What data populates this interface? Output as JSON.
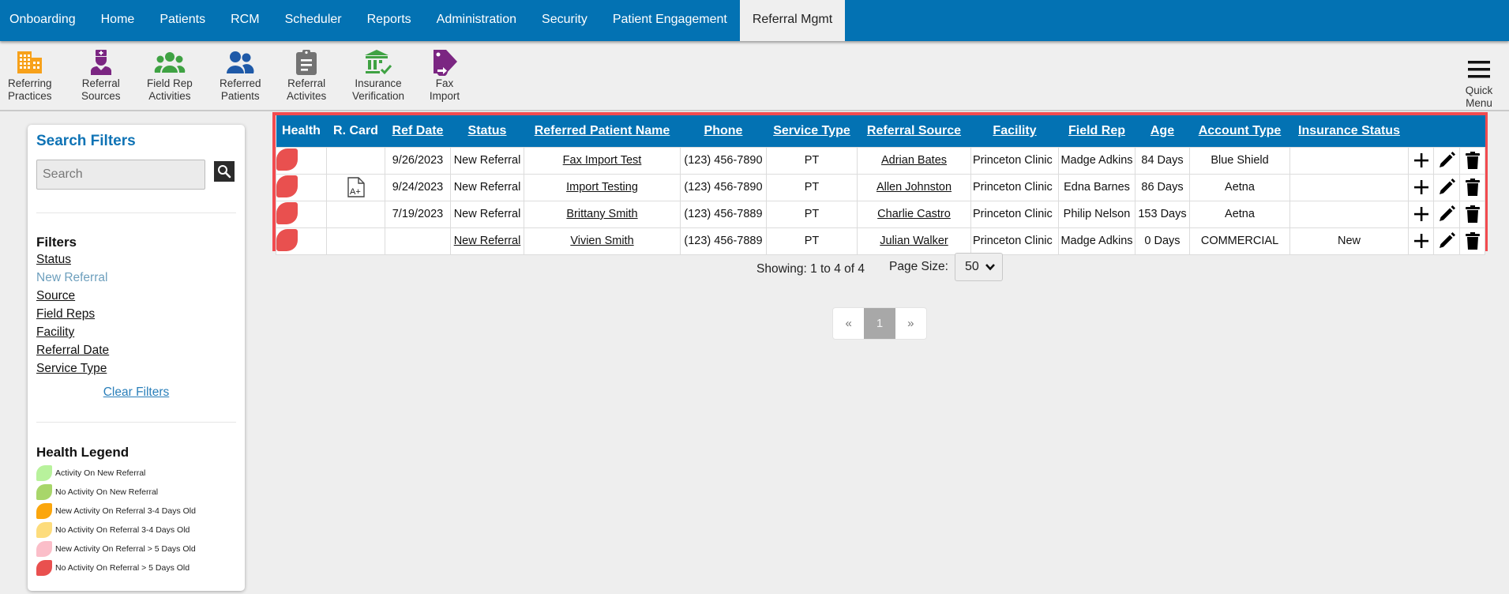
{
  "nav": {
    "items": [
      {
        "label": "Onboarding",
        "active": false
      },
      {
        "label": "Home",
        "active": false
      },
      {
        "label": "Patients",
        "active": false
      },
      {
        "label": "RCM",
        "active": false
      },
      {
        "label": "Scheduler",
        "active": false
      },
      {
        "label": "Reports",
        "active": false
      },
      {
        "label": "Administration",
        "active": false
      },
      {
        "label": "Security",
        "active": false
      },
      {
        "label": "Patient Engagement",
        "active": false
      },
      {
        "label": "Referral Mgmt",
        "active": true
      }
    ]
  },
  "toolbar": {
    "items": [
      {
        "line1": "Referring",
        "line2": "Practices",
        "icon": "building-icon",
        "color": "#f7a11a"
      },
      {
        "line1": "Referral",
        "line2": "Sources",
        "icon": "doctor-icon",
        "color": "#7b2682"
      },
      {
        "line1": "Field Rep",
        "line2": "Activities",
        "icon": "users-group-icon",
        "color": "#3fa243"
      },
      {
        "line1": "Referred",
        "line2": "Patients",
        "icon": "user-friends-icon",
        "color": "#1f5aa8"
      },
      {
        "line1": "Referral",
        "line2": "Activites",
        "icon": "clipboard-icon",
        "color": "#737373"
      },
      {
        "line1": "Insurance",
        "line2": "Verification",
        "icon": "bank-check-icon",
        "color": "#3fa243"
      },
      {
        "line1": "Fax",
        "line2": "Import",
        "icon": "tag-import-icon",
        "color": "#7b2682"
      }
    ],
    "quick_menu": {
      "line1": "Quick",
      "line2": "Menu",
      "icon": "hamburger-icon"
    }
  },
  "sidebar": {
    "title": "Search Filters",
    "search_placeholder": "Search",
    "search_value": "",
    "filters_title": "Filters",
    "status_label": "Status",
    "status_active": "New Referral",
    "filters": [
      "Source",
      "Field Reps",
      "Facility",
      "Referral Date",
      "Service Type"
    ],
    "clear_label": "Clear Filters",
    "legend_title": "Health Legend",
    "legend": [
      {
        "label": "Activity On New Referral",
        "color": "#b8f29c"
      },
      {
        "label": "No Activity On New Referral",
        "color": "#a8d66a"
      },
      {
        "label": "New Activity On Referral 3-4 Days Old",
        "color": "#fba60c"
      },
      {
        "label": "No Activity On Referral 3-4 Days Old",
        "color": "#fddc7c"
      },
      {
        "label": "New Activity On Referral > 5 Days Old",
        "color": "#fbbec9"
      },
      {
        "label": "No Activity On Referral > 5 Days Old",
        "color": "#e9504f"
      }
    ]
  },
  "table": {
    "columns": [
      {
        "label": "Health",
        "sortable": false
      },
      {
        "label": "R. Card",
        "sortable": false
      },
      {
        "label": "Ref Date",
        "sortable": true
      },
      {
        "label": "Status",
        "sortable": true
      },
      {
        "label": "Referred Patient Name",
        "sortable": true
      },
      {
        "label": "Phone",
        "sortable": true
      },
      {
        "label": "Service Type",
        "sortable": true
      },
      {
        "label": "Referral Source",
        "sortable": true
      },
      {
        "label": "Facility",
        "sortable": true
      },
      {
        "label": "Field Rep",
        "sortable": true
      },
      {
        "label": "Age",
        "sortable": true
      },
      {
        "label": "Account Type",
        "sortable": true
      },
      {
        "label": "Insurance Status",
        "sortable": true
      }
    ],
    "rows": [
      {
        "health_color": "#e9504f",
        "rcard": false,
        "ref_date": "9/26/2023",
        "status": "New Referral",
        "status_link": false,
        "patient": "Fax Import Test",
        "phone": "(123) 456-7890",
        "service": "PT",
        "source": "Adrian Bates",
        "facility": "Princeton Clinic",
        "field_rep": "Madge Adkins",
        "age": "84 Days",
        "account": "Blue Shield",
        "insurance_status": ""
      },
      {
        "health_color": "#e9504f",
        "rcard": true,
        "ref_date": "9/24/2023",
        "status": "New Referral",
        "status_link": false,
        "patient": "Import Testing",
        "phone": "(123) 456-7890",
        "service": "PT",
        "source": "Allen Johnston",
        "facility": "Princeton Clinic",
        "field_rep": "Edna Barnes",
        "age": "86 Days",
        "account": "Aetna",
        "insurance_status": ""
      },
      {
        "health_color": "#e9504f",
        "rcard": false,
        "ref_date": "7/19/2023",
        "status": "New Referral",
        "status_link": false,
        "patient": "Brittany Smith",
        "phone": "(123) 456-7889",
        "service": "PT",
        "source": "Charlie Castro",
        "facility": "Princeton Clinic",
        "field_rep": "Philip Nelson",
        "age": "153 Days",
        "account": "Aetna",
        "insurance_status": ""
      },
      {
        "health_color": "#e9504f",
        "rcard": false,
        "ref_date": "",
        "status": "New Referral",
        "status_link": true,
        "patient": "Vivien Smith",
        "phone": "(123) 456-7889",
        "service": "PT",
        "source": "Julian Walker",
        "facility": "Princeton Clinic",
        "field_rep": "Madge Adkins",
        "age": "0 Days",
        "account": "COMMERCIAL",
        "insurance_status": "New"
      }
    ],
    "row_actions": [
      "plus-icon",
      "pencil-icon",
      "trash-icon"
    ]
  },
  "pagination": {
    "showing": "Showing: 1 to 4 of 4",
    "page_size_label": "Page Size:",
    "page_size": "50",
    "prev": "«",
    "current_page": "1",
    "next": "»"
  }
}
